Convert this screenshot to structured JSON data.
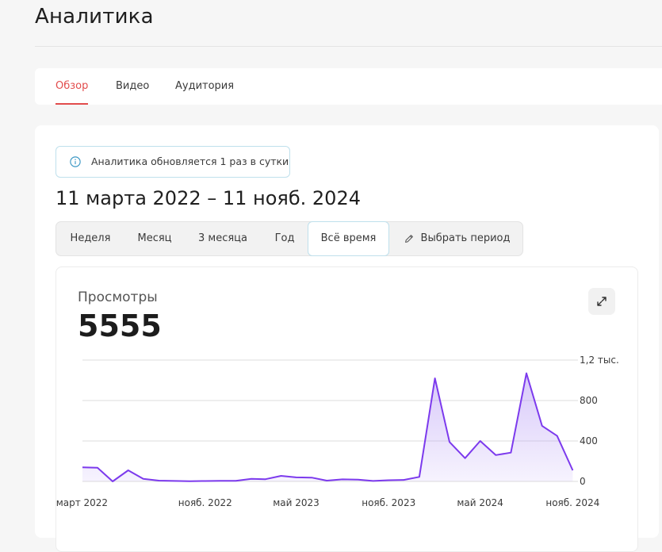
{
  "page": {
    "title": "Аналитика"
  },
  "tabs": [
    {
      "label": "Обзор",
      "active": true
    },
    {
      "label": "Видео",
      "active": false
    },
    {
      "label": "Аудитория",
      "active": false
    }
  ],
  "info_banner": {
    "icon": "info-icon",
    "text": "Аналитика обновляется 1 раз в сутки"
  },
  "date_range": "11 марта 2022 – 11 нояб. 2024",
  "period_buttons": [
    {
      "label": "Неделя",
      "active": false
    },
    {
      "label": "Месяц",
      "active": false
    },
    {
      "label": "3 месяца",
      "active": false
    },
    {
      "label": "Год",
      "active": false
    },
    {
      "label": "Всё время",
      "active": true
    },
    {
      "label": "Выбрать период",
      "active": false,
      "icon": "pencil-icon"
    }
  ],
  "views_card": {
    "label": "Просмотры",
    "value": "5555",
    "expand_icon": "expand-icon"
  },
  "colors": {
    "accent_tab": "#e24c4c",
    "line": "#7c3aed",
    "area": "#b79cf5",
    "info_border": "#bfe0ec"
  },
  "chart_data": {
    "type": "area",
    "x_tick_labels": [
      "март 2022",
      "нояб. 2022",
      "май 2023",
      "нояб. 2023",
      "май 2024",
      "нояб. 2024"
    ],
    "x_tick_dates": [
      "2022-03",
      "2022-11",
      "2023-05",
      "2023-11",
      "2024-05",
      "2024-11"
    ],
    "y_tick_labels": [
      "0",
      "400",
      "800",
      "1,2 тыс."
    ],
    "y_ticks": [
      0,
      400,
      800,
      1200
    ],
    "ylim": [
      0,
      1200
    ],
    "xlim": [
      "2022-03-11",
      "2024-11-11"
    ],
    "grid": true,
    "series": [
      {
        "points": [
          [
            "2022-03-11",
            140
          ],
          [
            "2022-04-10",
            135
          ],
          [
            "2022-05-10",
            0
          ],
          [
            "2022-06-10",
            110
          ],
          [
            "2022-07-10",
            25
          ],
          [
            "2022-08-10",
            8
          ],
          [
            "2022-09-10",
            5
          ],
          [
            "2022-10-10",
            2
          ],
          [
            "2022-11-10",
            4
          ],
          [
            "2022-12-10",
            6
          ],
          [
            "2023-01-10",
            6
          ],
          [
            "2023-02-10",
            25
          ],
          [
            "2023-03-10",
            22
          ],
          [
            "2023-04-10",
            55
          ],
          [
            "2023-05-10",
            40
          ],
          [
            "2023-06-10",
            38
          ],
          [
            "2023-07-10",
            8
          ],
          [
            "2023-08-10",
            20
          ],
          [
            "2023-09-10",
            18
          ],
          [
            "2023-10-10",
            5
          ],
          [
            "2023-11-10",
            12
          ],
          [
            "2023-12-10",
            15
          ],
          [
            "2024-01-10",
            45
          ],
          [
            "2024-02-10",
            1020
          ],
          [
            "2024-03-10",
            390
          ],
          [
            "2024-04-10",
            230
          ],
          [
            "2024-05-10",
            400
          ],
          [
            "2024-06-10",
            260
          ],
          [
            "2024-07-10",
            285
          ],
          [
            "2024-08-10",
            1070
          ],
          [
            "2024-09-10",
            550
          ],
          [
            "2024-10-10",
            450
          ],
          [
            "2024-11-10",
            110
          ]
        ]
      }
    ]
  }
}
